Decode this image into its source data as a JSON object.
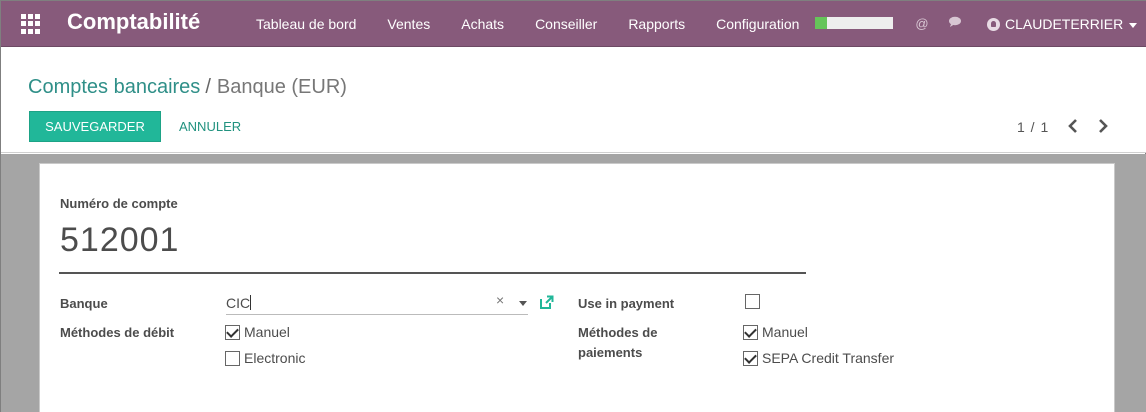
{
  "navbar": {
    "app_title": "Comptabilité",
    "menu": [
      "Tableau de bord",
      "Ventes",
      "Achats",
      "Conseiller",
      "Rapports",
      "Configuration"
    ],
    "progress_fraction": 0.15,
    "user_name": "CLAUDETERRIER"
  },
  "breadcrumb": {
    "parent": "Comptes bancaires",
    "separator": "/",
    "current": "Banque (EUR)"
  },
  "actions": {
    "save_label": "SAUVEGARDER",
    "cancel_label": "ANNULER"
  },
  "pager": {
    "text": "1 / 1"
  },
  "form": {
    "account_number_label": "Numéro de compte",
    "account_number_value": "512001",
    "bank_label": "Banque",
    "bank_value": "CIC",
    "bank_clear": "×",
    "debit_methods_label": "Méthodes de débit",
    "debit_methods": [
      {
        "label": "Manuel",
        "checked": true
      },
      {
        "label": "Electronic",
        "checked": false
      }
    ],
    "use_in_payment_label": "Use in payment",
    "use_in_payment_checked": false,
    "payment_methods_label_line1": "Méthodes de",
    "payment_methods_label_line2": "paiements",
    "payment_methods": [
      {
        "label": "Manuel",
        "checked": true
      },
      {
        "label": "SEPA Credit Transfer",
        "checked": true
      }
    ]
  },
  "colors": {
    "navbar": "#875a7b",
    "primary_button": "#21b799",
    "link": "#2f8f88",
    "progress": "#66c45a"
  }
}
